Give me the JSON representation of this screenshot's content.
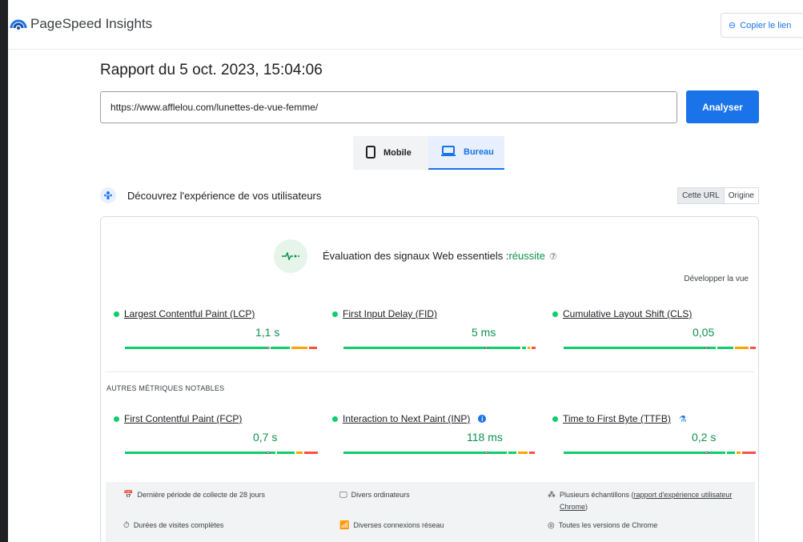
{
  "header": {
    "app_title": "PageSpeed Insights",
    "copy_label": "Copier le lien",
    "copy_icon": "link-icon",
    "logo_icon": "pagespeed-logo-icon"
  },
  "report": {
    "title": "Rapport du 5 oct. 2023, 15:04:06",
    "url_value": "https://www.afflelou.com/lunettes-de-vue-femme/",
    "analyze_label": "Analyser"
  },
  "device_tabs": {
    "mobile": "Mobile",
    "desktop": "Bureau",
    "selected": "Bureau"
  },
  "users_section": {
    "title": "Découvrez l'expérience de vos utilisateurs",
    "toggle_url": "Cette URL",
    "toggle_origin": "Origine"
  },
  "assessment": {
    "prefix": "Évaluation des signaux Web essentiels :",
    "result": "réussite",
    "help": "⑦",
    "expand": "Développer la vue"
  },
  "core_metrics": [
    {
      "name": "Largest Contentful Paint (LCP)",
      "value": "1,1 s",
      "marker_pct": 0.74,
      "bar": [
        0.76,
        0.11,
        0.09,
        0.04
      ]
    },
    {
      "name": "First Input Delay (FID)",
      "value": "5 ms",
      "marker_pct": 0.74,
      "bar": [
        0.93,
        0.03,
        0.02,
        0.02
      ]
    },
    {
      "name": "Cumulative Layout Shift (CLS)",
      "value": "0,05",
      "marker_pct": 0.74,
      "bar": [
        0.8,
        0.09,
        0.08,
        0.03
      ]
    }
  ],
  "other_label": "AUTRES MÉTRIQUES NOTABLES",
  "other_metrics": [
    {
      "name": "First Contentful Paint (FCP)",
      "value": "0,7 s",
      "marker_pct": 0.74,
      "bar": [
        0.79,
        0.1,
        0.04,
        0.07
      ]
    },
    {
      "name": "Interaction to Next Paint (INP)",
      "value": "118 ms",
      "marker_pct": 0.74,
      "bar": [
        0.86,
        0.05,
        0.06,
        0.03
      ]
    },
    {
      "name": "Time to First Byte (TTFB)",
      "value": "0,2 s",
      "marker_pct": 0.74,
      "bar": [
        0.85,
        0.05,
        0.03,
        0.07
      ]
    }
  ],
  "colors": {
    "good": "#0cce6b",
    "needs_improvement": "#ffa400",
    "poor": "#ff4e42",
    "accent": "#1a73e8"
  },
  "footer": {
    "period": "Dernière période de collecte de 28 jours",
    "devices": "Divers ordinateurs",
    "samples_prefix": "Plusieurs échantillons (",
    "samples_link": "rapport d'expérience utilisateur Chrome",
    "samples_suffix": ")",
    "visits": "Durées de visites complètes",
    "network": "Diverses connexions réseau",
    "chrome": "Toutes les versions de Chrome"
  }
}
